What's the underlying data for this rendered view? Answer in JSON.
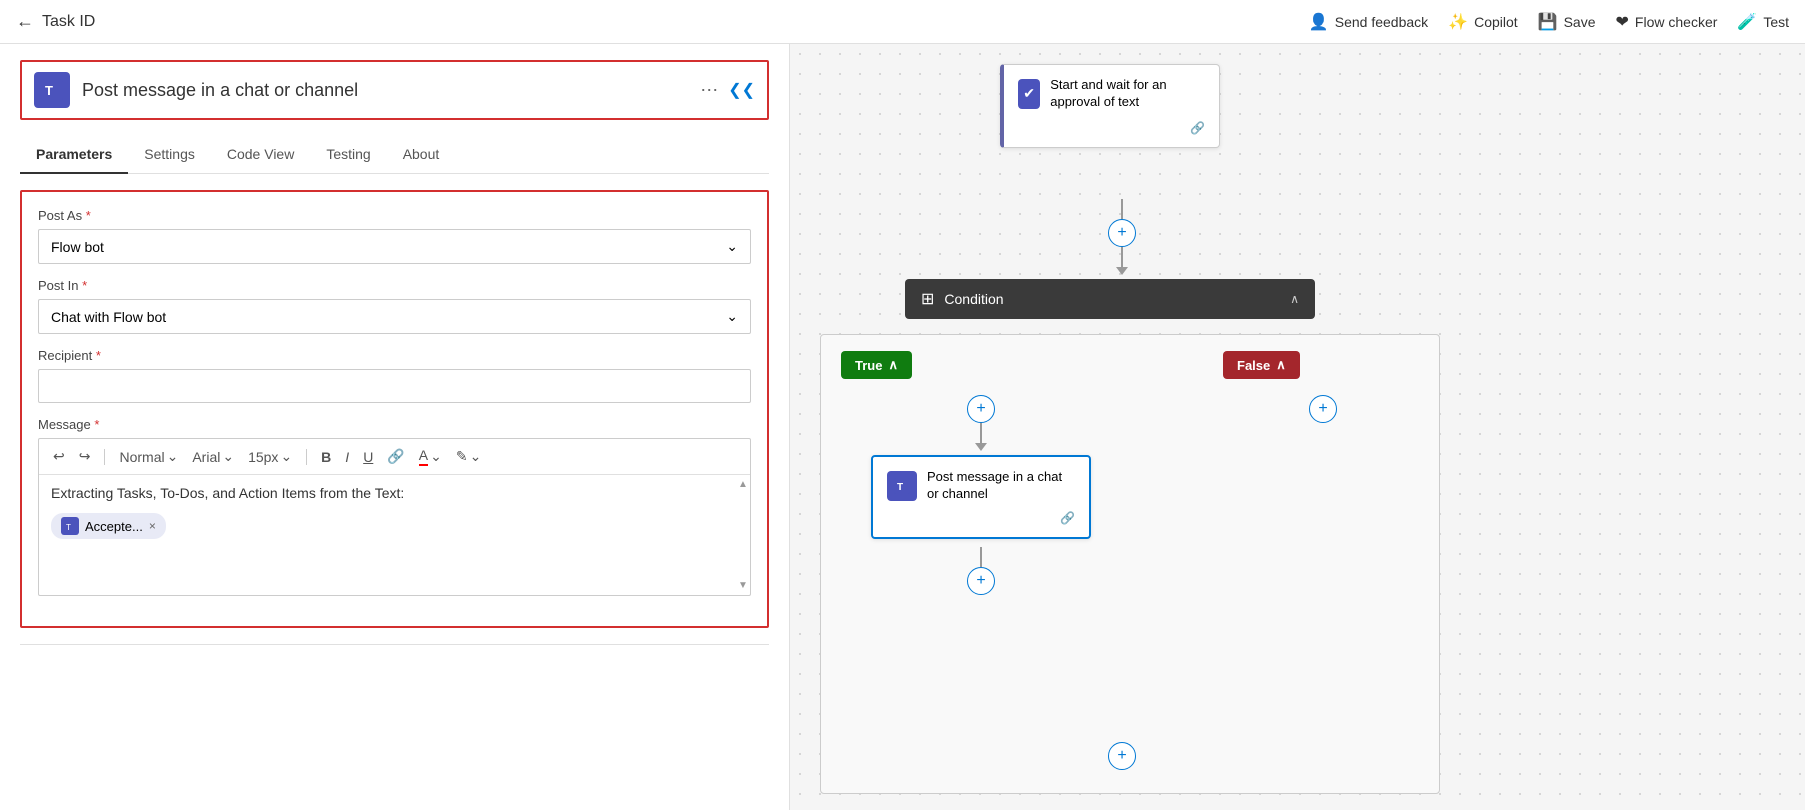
{
  "topbar": {
    "back_icon": "←",
    "title": "Task ID",
    "actions": [
      {
        "id": "send-feedback",
        "icon": "👤",
        "label": "Send feedback"
      },
      {
        "id": "copilot",
        "icon": "✨",
        "label": "Copilot"
      },
      {
        "id": "save",
        "icon": "💾",
        "label": "Save"
      },
      {
        "id": "flow-checker",
        "icon": "♥",
        "label": "Flow checker"
      },
      {
        "id": "test",
        "icon": "🧪",
        "label": "Test"
      }
    ]
  },
  "left_panel": {
    "header": {
      "icon": "T",
      "title": "Post message in a chat or channel"
    },
    "tabs": [
      {
        "id": "parameters",
        "label": "Parameters",
        "active": true
      },
      {
        "id": "settings",
        "label": "Settings",
        "active": false
      },
      {
        "id": "code-view",
        "label": "Code View",
        "active": false
      },
      {
        "id": "testing",
        "label": "Testing",
        "active": false
      },
      {
        "id": "about",
        "label": "About",
        "active": false
      }
    ],
    "form": {
      "post_as_label": "Post As",
      "post_as_value": "Flow bot",
      "post_in_label": "Post In",
      "post_in_value": "Chat with Flow bot",
      "recipient_label": "Recipient",
      "recipient_value": "",
      "recipient_placeholder": "",
      "message_label": "Message",
      "message_text": "Extracting Tasks, To-Dos, and Action Items from the Text:",
      "message_tag": "Accepte...",
      "toolbar": {
        "undo": "↩",
        "redo": "↪",
        "style": "Normal",
        "font": "Arial",
        "size": "15px",
        "bold": "B",
        "italic": "I",
        "underline": "U",
        "link": "🔗",
        "font_color": "A",
        "highlight": "🖌"
      }
    }
  },
  "flow": {
    "approval_node": {
      "title": "Start and wait for an approval of text",
      "icon": "✔"
    },
    "condition_node": {
      "title": "Condition",
      "icon": "⊞"
    },
    "true_branch": {
      "label": "True",
      "chevron": "∧"
    },
    "false_branch": {
      "label": "False",
      "chevron": "∧"
    },
    "post_msg_node": {
      "title": "Post message in a chat or channel",
      "icon": "T"
    },
    "add_label": "+"
  }
}
